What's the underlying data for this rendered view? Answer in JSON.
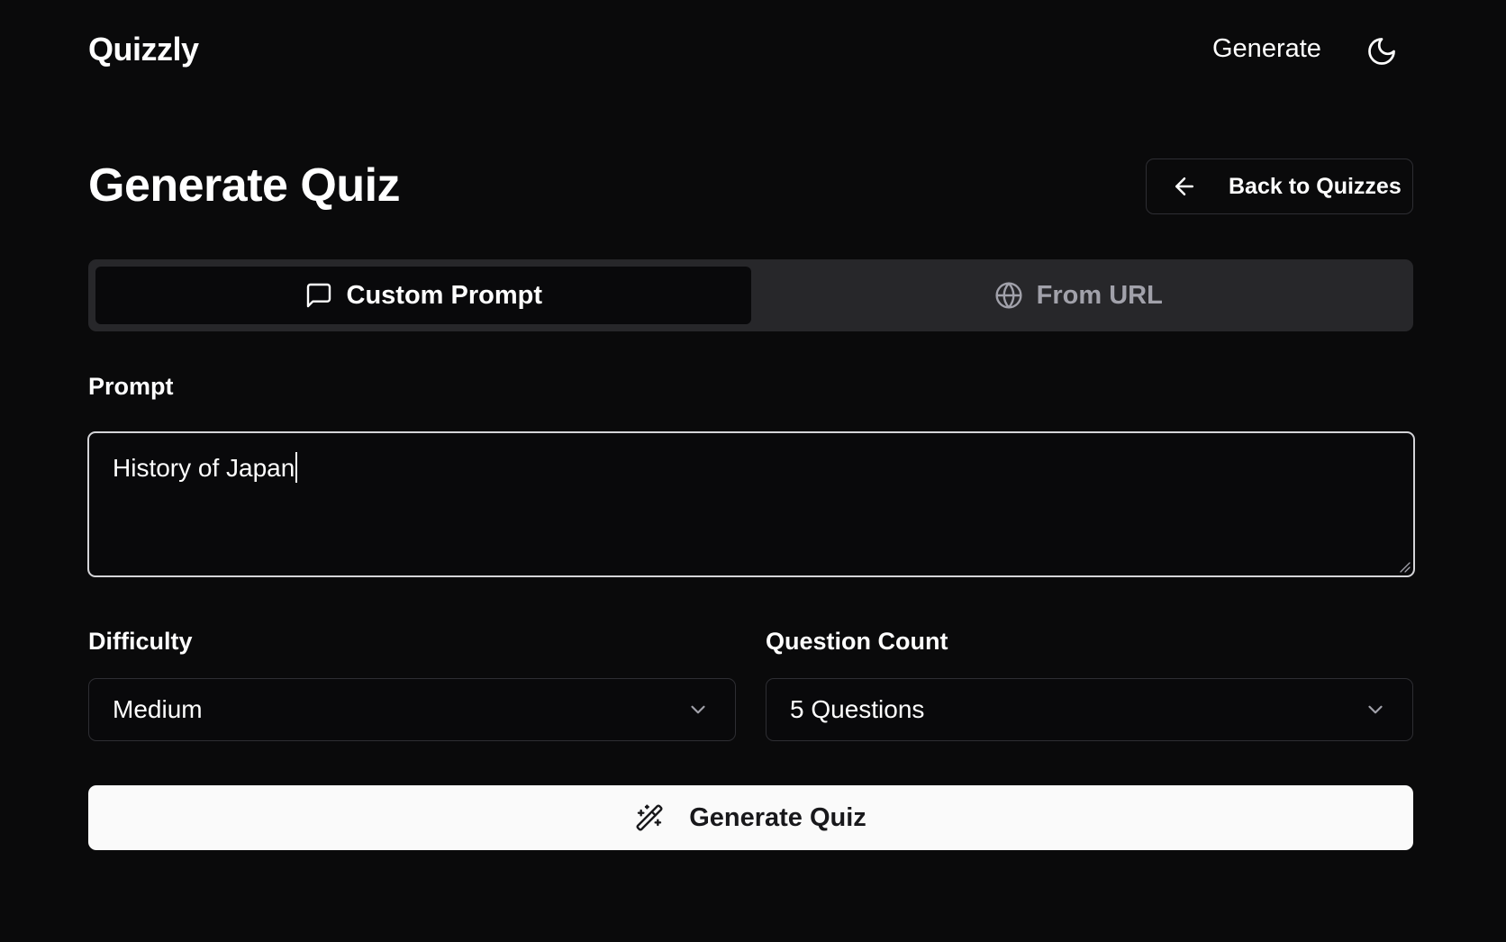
{
  "header": {
    "logo": "Quizzly",
    "nav_generate": "Generate",
    "theme_toggle_icon": "moon-icon"
  },
  "page": {
    "title": "Generate Quiz",
    "back_button": {
      "label": "Back to Quizzes",
      "icon": "arrow-left-icon"
    }
  },
  "tabs": [
    {
      "label": "Custom Prompt",
      "icon": "message-square-icon",
      "active": true
    },
    {
      "label": "From URL",
      "icon": "globe-icon",
      "active": false
    }
  ],
  "form": {
    "prompt": {
      "label": "Prompt",
      "value": "History of Japan"
    },
    "difficulty": {
      "label": "Difficulty",
      "selected": "Medium"
    },
    "question_count": {
      "label": "Question Count",
      "selected": "5 Questions"
    },
    "submit": {
      "label": "Generate Quiz",
      "icon": "wand-sparkles-icon"
    }
  },
  "colors": {
    "background": "#0a0a0b",
    "foreground": "#fafafa",
    "tab_bar": "#27272a",
    "border": "#2e2e33",
    "muted_text": "#a1a1aa",
    "primary_button_bg": "#fafafa",
    "primary_button_text": "#18181b"
  }
}
